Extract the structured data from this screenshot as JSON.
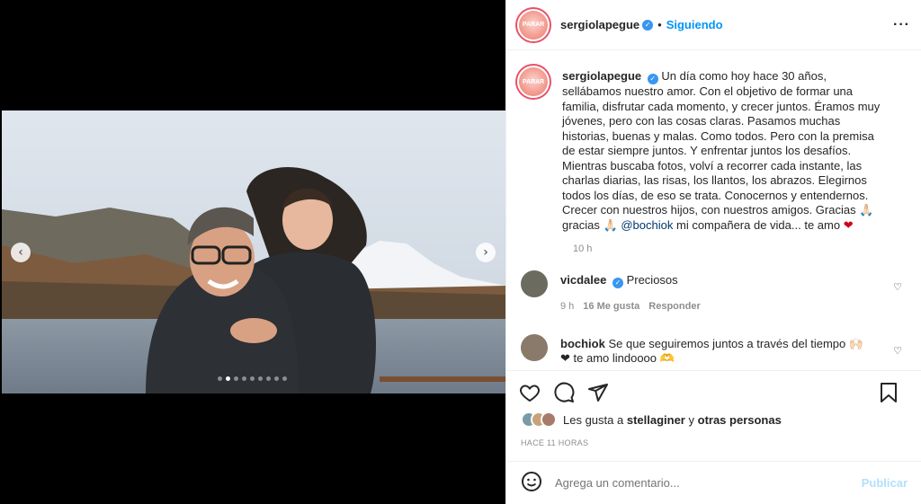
{
  "post": {
    "username": "sergiolapegue",
    "avatar_text": "PARAR",
    "follow_status": "Siguiendo",
    "caption_text": "Un día como hoy hace 30 años, sellábamos nuestro amor. Con el objetivo de formar una familia, disfrutar cada momento, y crecer juntos. Éramos muy jóvenes, pero con las cosas claras. Pasamos muchas historias, buenas y malas. Como todos. Pero con la premisa de estar siempre juntos. Y enfrentar juntos los desafíos. Mientras buscaba fotos, volví a recorrer cada instante, las charlas diarias, las risas, los llantos, los abrazos. Elegirnos todos los días, de eso se trata. Conocernos y entendernos. Crecer con nuestros hijos, con nuestros amigos. Gracias 🙏🏻 gracias 🙏🏻",
    "caption_mention": "@bochiok",
    "caption_end": "mi compañera de vida... te amo",
    "caption_heart": "❤",
    "caption_time": "10 h"
  },
  "comments": [
    {
      "username": "vicdalee",
      "verified": true,
      "text": "Preciosos",
      "time": "9 h",
      "likes": "16 Me gusta",
      "reply": "Responder",
      "avatar_color": "#6b6b60"
    },
    {
      "username": "bochiok",
      "verified": false,
      "text": "Se que seguiremos juntos a través del tiempo 🙌🏻❤ te amo lindoooo 🫶",
      "avatar_color": "#8a7a6a"
    }
  ],
  "likes": {
    "prefix": "Les gusta a",
    "user": "stellaginer",
    "connector": "y",
    "others": "otras personas",
    "avatar_colors": [
      "#7a9aa8",
      "#c9a27a",
      "#a87a6a"
    ]
  },
  "posted_ago": "HACE 11 HORAS",
  "compose": {
    "placeholder": "Agrega un comentario...",
    "publish_label": "Publicar"
  },
  "carousel": {
    "prev_icon": "‹",
    "next_icon": "›",
    "dot_count": 9,
    "active_index": 1
  },
  "colors": {
    "accent": "#0095f6",
    "verified": "#3897f0",
    "heart": "#d0021b"
  }
}
